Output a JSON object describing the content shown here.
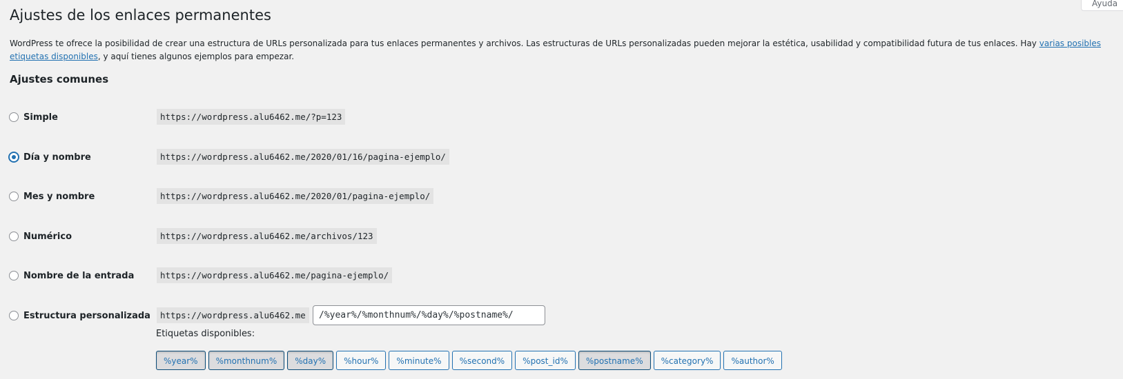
{
  "help_tab": {
    "label": "Ayuda"
  },
  "page": {
    "title": "Ajustes de los enlaces permanentes",
    "intro_text": "WordPress te ofrece la posibilidad de crear una estructura de URLs personalizada para tus enlaces permanentes y archivos. Las estructuras de URLs personalizadas pueden mejorar la estética, usabilidad y compatibilidad futura de tus enlaces. Hay ",
    "intro_link": "varias posibles etiquetas disponibles",
    "intro_after": ", y aquí tienes algunos ejemplos para empezar."
  },
  "common": {
    "heading": "Ajustes comunes",
    "options": [
      {
        "label": "Simple",
        "example": "https://wordpress.alu6462.me/?p=123",
        "checked": false
      },
      {
        "label": "Día y nombre",
        "example": "https://wordpress.alu6462.me/2020/01/16/pagina-ejemplo/",
        "checked": true
      },
      {
        "label": "Mes y nombre",
        "example": "https://wordpress.alu6462.me/2020/01/pagina-ejemplo/",
        "checked": false
      },
      {
        "label": "Numérico",
        "example": "https://wordpress.alu6462.me/archivos/123",
        "checked": false
      },
      {
        "label": "Nombre de la entrada",
        "example": "https://wordpress.alu6462.me/pagina-ejemplo/",
        "checked": false
      },
      {
        "label": "Estructura personalizada",
        "example": "https://wordpress.alu6462.me",
        "checked": false
      }
    ],
    "custom_value": "/%year%/%monthnum%/%day%/%postname%/"
  },
  "tags": {
    "label": "Etiquetas disponibles:",
    "items": [
      {
        "label": "%year%",
        "active": true
      },
      {
        "label": "%monthnum%",
        "active": true
      },
      {
        "label": "%day%",
        "active": true
      },
      {
        "label": "%hour%",
        "active": false
      },
      {
        "label": "%minute%",
        "active": false
      },
      {
        "label": "%second%",
        "active": false
      },
      {
        "label": "%post_id%",
        "active": false
      },
      {
        "label": "%postname%",
        "active": true
      },
      {
        "label": "%category%",
        "active": false
      },
      {
        "label": "%author%",
        "active": false
      }
    ]
  }
}
